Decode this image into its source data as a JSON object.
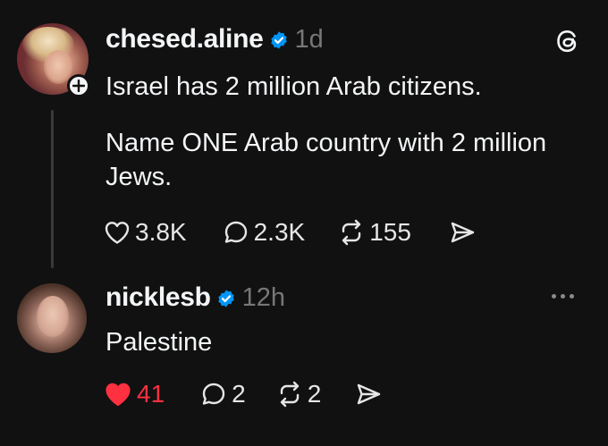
{
  "posts": [
    {
      "username": "chesed.aline",
      "time": "1d",
      "verified": true,
      "text_line1": "Israel has 2 million Arab citizens.",
      "text_body": "Name ONE Arab country with 2 million Jews.",
      "likes": "3.8K",
      "replies": "2.3K",
      "reposts": "155",
      "liked": false,
      "icon_top_right": "threads-logo-icon"
    },
    {
      "username": "nicklesb",
      "time": "12h",
      "verified": true,
      "text_body": "Palestine",
      "likes": "41",
      "replies": "2",
      "reposts": "2",
      "liked": true,
      "icon_top_right": "more-options-icon"
    }
  ],
  "colors": {
    "background": "#111111",
    "text": "#f3f5f7",
    "muted": "#777777",
    "verified": "#0095f6",
    "like_active": "#ff3040"
  }
}
